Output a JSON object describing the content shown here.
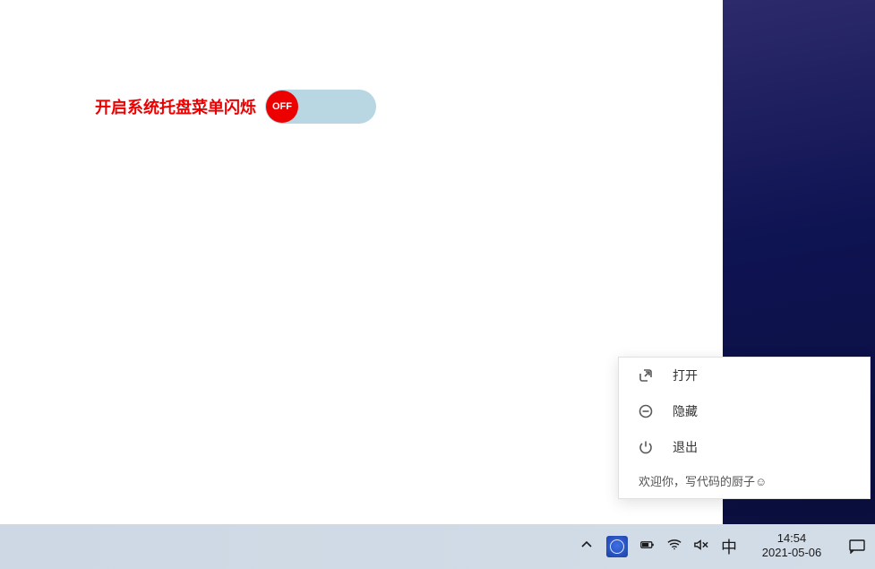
{
  "app": {
    "toggle_label": "开启系统托盘菜单闪烁",
    "toggle_state_text": "OFF",
    "toggle_state": "off"
  },
  "menu": {
    "items": [
      {
        "icon": "open-icon",
        "label": "打开"
      },
      {
        "icon": "hide-icon",
        "label": "隐藏"
      },
      {
        "icon": "exit-icon",
        "label": "退出"
      }
    ],
    "footer": "欢迎你，写代码的厨子☺"
  },
  "taskbar": {
    "ime_text": "中",
    "time": "14:54",
    "date": "2021-05-06"
  },
  "colors": {
    "accent_red": "#ed0000",
    "toggle_track": "#b8d7e3",
    "wallpaper_dark": "#0b0f3d"
  }
}
